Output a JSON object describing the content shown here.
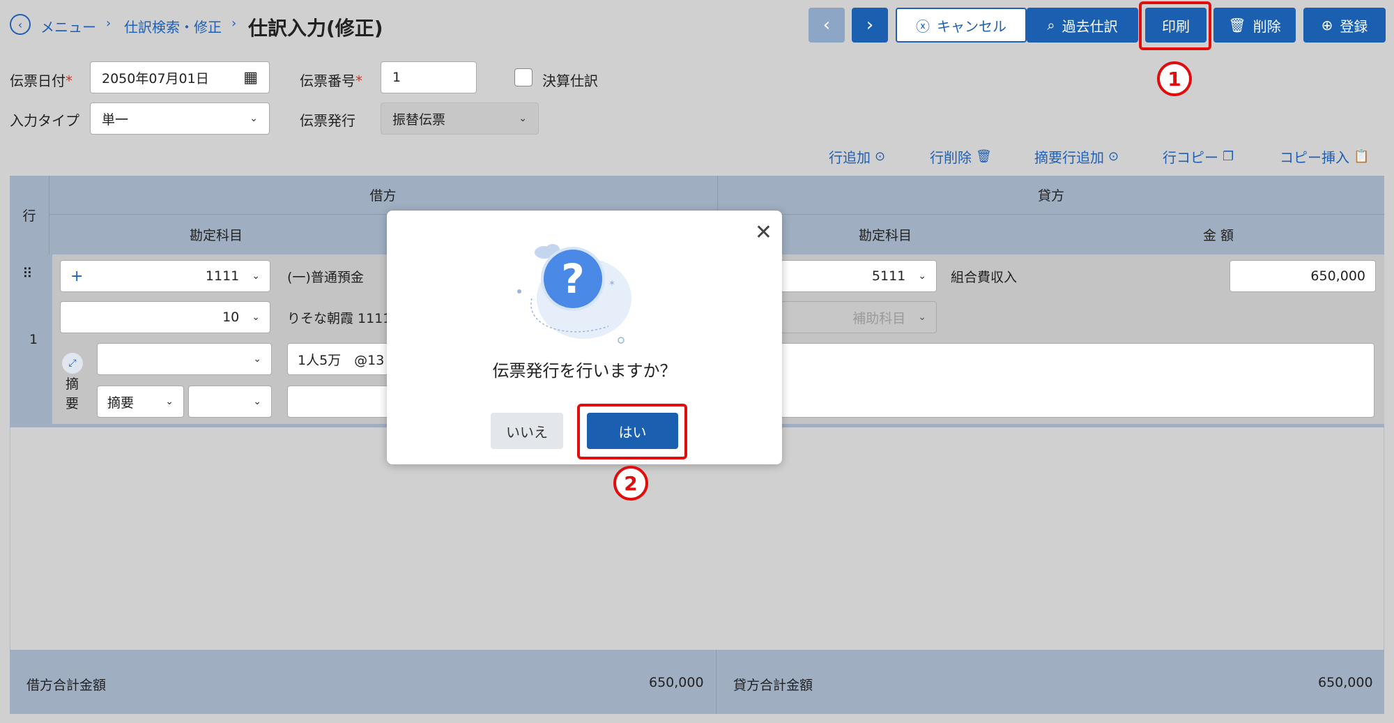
{
  "header": {
    "breadcrumb": [
      "メニュー",
      "仕訳検索・修正"
    ],
    "title": "仕訳入力(修正)",
    "buttons": {
      "cancel": "キャンセル",
      "past": "過去仕訳",
      "print": "印刷",
      "delete": "削除",
      "register": "登録"
    }
  },
  "form": {
    "date_label": "伝票日付",
    "date_value": "2050年07月01日",
    "number_label": "伝票番号",
    "number_value": "1",
    "closing_label": "決算仕訳",
    "input_type_label": "入力タイプ",
    "input_type_value": "単一",
    "issue_label": "伝票発行",
    "issue_value": "振替伝票"
  },
  "toolbar": {
    "add_row": "行追加",
    "delete_row": "行削除",
    "add_summary_row": "摘要行追加",
    "copy_row": "行コピー",
    "copy_insert": "コピー挿入"
  },
  "table": {
    "row_header": "行",
    "debit": "借方",
    "credit": "貸方",
    "account": "勘定科目",
    "amount": "金 額",
    "row_number": "1",
    "debit_code": "1111",
    "debit_name": "(一)普通預金",
    "debit_sub_code": "10",
    "debit_sub_name": "りそな朝霞 1111",
    "credit_code": "5111",
    "credit_name": "組合費収入",
    "credit_amount": "650,000",
    "credit_sub_placeholder": "補助科目",
    "summary_label_1": "摘",
    "summary_label_2": "要",
    "summary_text": "1人5万　@13",
    "summary_select": "摘要"
  },
  "footer": {
    "debit_total_label": "借方合計金額",
    "debit_total": "650,000",
    "credit_total_label": "貸方合計金額",
    "credit_total": "650,000"
  },
  "modal": {
    "question": "伝票発行を行いますか？",
    "no": "いいえ",
    "yes": "はい"
  },
  "annotations": {
    "marker1": "1",
    "marker2": "2"
  },
  "colors": {
    "primary": "#1a5fb0",
    "highlight": "#e10d0d",
    "table_header": "#9faec1"
  }
}
